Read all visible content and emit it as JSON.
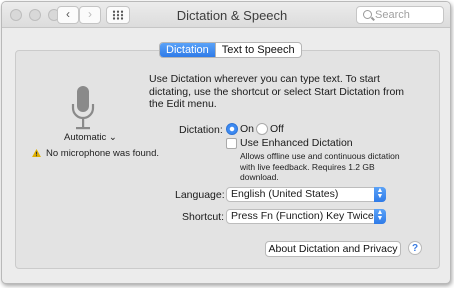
{
  "window": {
    "title": "Dictation & Speech"
  },
  "toolbar": {
    "back_glyph": "‹",
    "forward_glyph": "›",
    "show_all_icon": "grid-icon"
  },
  "search": {
    "placeholder": "Search"
  },
  "tabs": [
    {
      "label": "Dictation",
      "selected": true
    },
    {
      "label": "Text to Speech",
      "selected": false
    }
  ],
  "mic": {
    "source_label": "Automatic ⌄",
    "warning": "No microphone was found."
  },
  "description": "Use Dictation wherever you can type text. To start dictating, use the shortcut or select Start Dictation from the Edit menu.",
  "dictation": {
    "label": "Dictation:",
    "on_label": "On",
    "off_label": "Off",
    "selected": "On"
  },
  "enhanced": {
    "label": "Use Enhanced Dictation",
    "checked": false,
    "description": "Allows offline use and continuous dictation with live feedback. Requires 1.2 GB download."
  },
  "language": {
    "label": "Language:",
    "value": "English (United States)"
  },
  "shortcut": {
    "label": "Shortcut:",
    "value": "Press Fn (Function) Key Twice"
  },
  "buttons": {
    "about": "About Dictation and Privacy",
    "help": "?"
  },
  "colors": {
    "accent": "#3d8af2",
    "warning": "#e0b000"
  }
}
